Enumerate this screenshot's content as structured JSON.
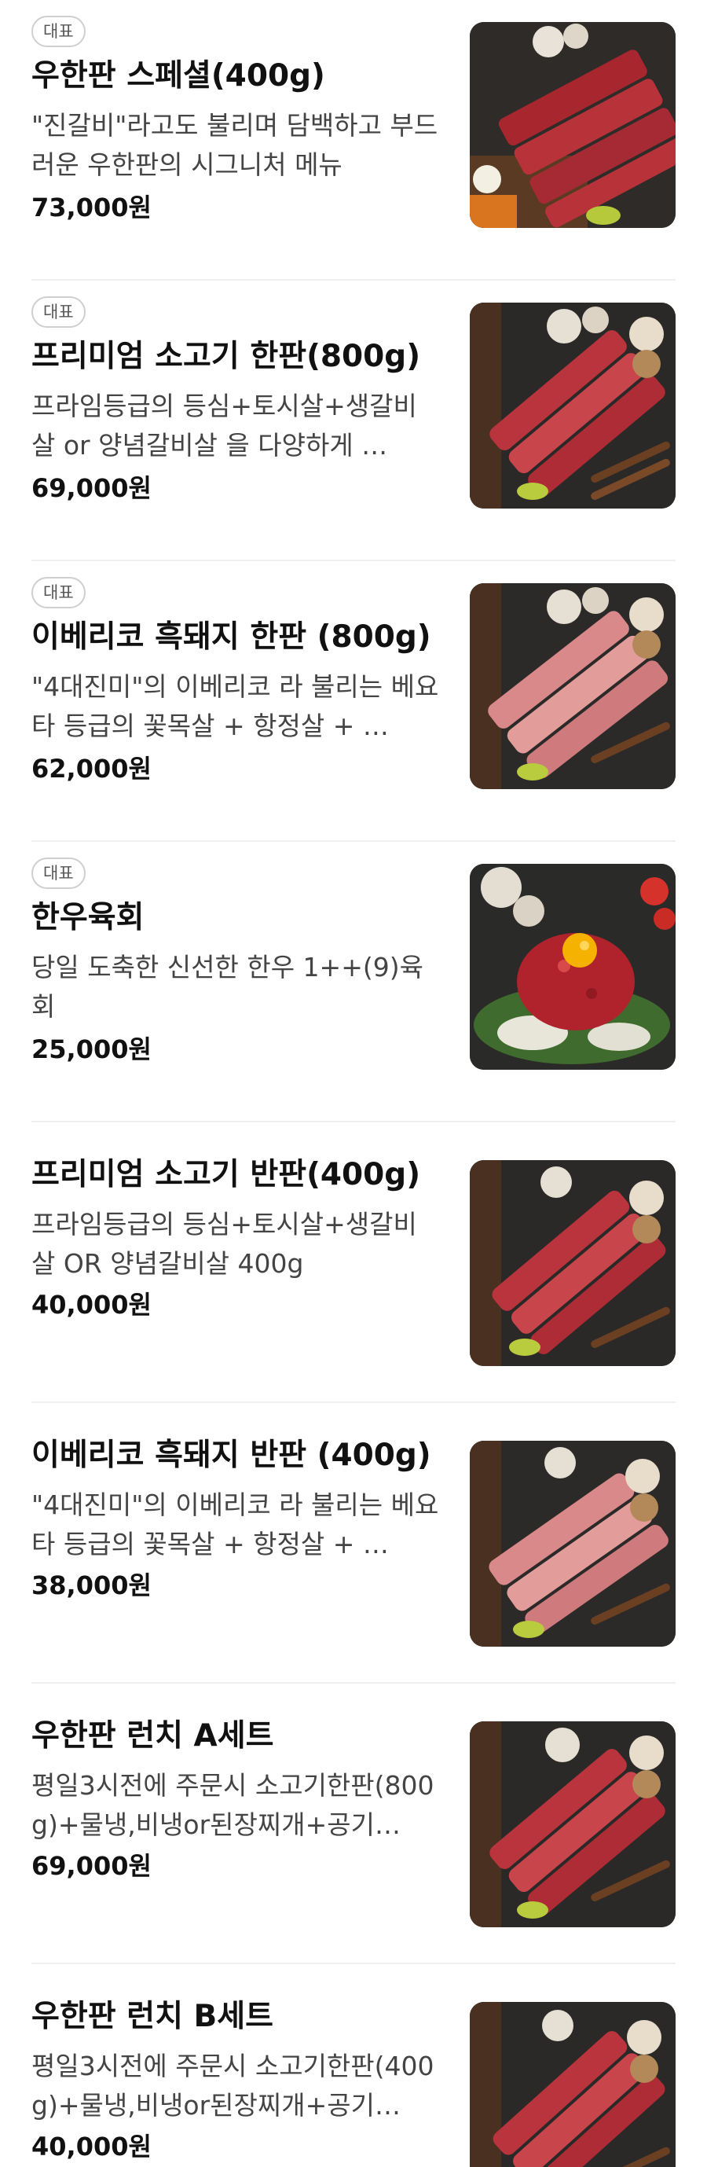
{
  "menu": {
    "items": [
      {
        "badge": "대표",
        "name": "우한판 스페셜(400g)",
        "description": "\"진갈비\"라고도 불리며 담백하고 부드러운 우한판의 시그니처 메뉴",
        "price": "73,000원",
        "image": "beef-platter-photo"
      },
      {
        "badge": "대표",
        "name": "프리미엄 소고기 한판(800g)",
        "description": "프라임등급의 등심+토시살+생갈비살 or 양념갈비살 을 다양하게 …",
        "price": "69,000원",
        "image": "beef-platter-photo"
      },
      {
        "badge": "대표",
        "name": "이베리코 흑돼지 한판 (800g)",
        "description": "\"4대진미\"의 이베리코 라 불리는 베요타 등급의 꽃목살 + 항정살 + …",
        "price": "62,000원",
        "image": "pork-platter-photo"
      },
      {
        "badge": "대표",
        "name": "한우육회",
        "description": "당일 도축한 신선한 한우 1++(9)육회",
        "price": "25,000원",
        "image": "yukhoe-photo"
      },
      {
        "badge": "",
        "name": "프리미엄 소고기 반판(400g)",
        "description": "프라임등급의 등심+토시살+생갈비살 OR 양념갈비살 400g",
        "price": "40,000원",
        "image": "beef-platter-photo"
      },
      {
        "badge": "",
        "name": "이베리코 흑돼지 반판 (400g)",
        "description": "\"4대진미\"의 이베리코 라 불리는 베요타 등급의 꽃목살 + 항정살 + …",
        "price": "38,000원",
        "image": "pork-platter-photo"
      },
      {
        "badge": "",
        "name": "우한판 런치 A세트",
        "description": "평일3시전에 주문시 소고기한판(800g)+물냉,비냉or된장찌개+공기…",
        "price": "69,000원",
        "image": "beef-platter-photo"
      },
      {
        "badge": "",
        "name": "우한판 런치 B세트",
        "description": "평일3시전에 주문시 소고기한판(400g)+물냉,비냉or된장찌개+공기…",
        "price": "40,000원",
        "image": "beef-platter-photo"
      }
    ]
  },
  "colors": {
    "text": "#111111",
    "description": "#444444",
    "badge_border": "#cfcfcf",
    "divider": "#efefef",
    "beef": "#b8323a",
    "pork": "#d98a87"
  }
}
